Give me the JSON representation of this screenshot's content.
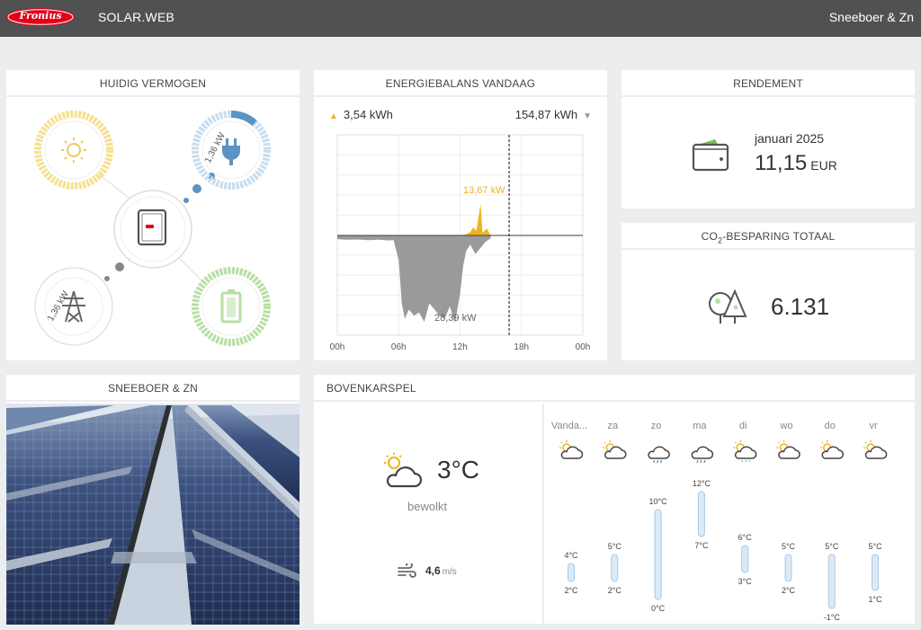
{
  "header": {
    "brand": "Fronius",
    "app_title": "SOLAR.WEB",
    "account_name": "Sneeboer & Zn",
    "brand_color": "#e2001a"
  },
  "power_flow": {
    "title": "HUIDIG VERMOGEN",
    "load_power": "1,36 kW",
    "grid_power": "1,36 kW",
    "nodes": [
      "sun-icon",
      "plug-icon",
      "inverter-icon",
      "grid-tower-icon",
      "battery-icon"
    ],
    "colors": {
      "pv": "#f6e08e",
      "load": "#a9c9e2",
      "load_accent": "#5b93c2",
      "battery": "#b7dfa2",
      "grid": "#dddddd"
    }
  },
  "energy_balance": {
    "title": "ENERGIEBALANS VANDAAG",
    "production": "3,54 kWh",
    "consumption": "154,87 kWh",
    "peak_label": "13,67 kW",
    "min_label": "28,39 kW",
    "accent": "#f0b41a",
    "chart_data": {
      "type": "area",
      "x_ticks": [
        "00h",
        "06h",
        "12h",
        "18h",
        "00h"
      ],
      "ylim": [
        -30,
        30
      ],
      "series": [
        {
          "values": [
            [
              0,
              -1.2
            ],
            [
              1,
              -1.4
            ],
            [
              2,
              -1.3
            ],
            [
              3,
              -1.5
            ],
            [
              4,
              -1.4
            ],
            [
              5,
              -1.6
            ],
            [
              5.5,
              -1.5
            ],
            [
              6,
              -8
            ],
            [
              6.3,
              -22
            ],
            [
              6.6,
              -27
            ],
            [
              7,
              -24
            ],
            [
              7.5,
              -26
            ],
            [
              8,
              -25
            ],
            [
              8.5,
              -28
            ],
            [
              9,
              -22
            ],
            [
              9.5,
              -24
            ],
            [
              10,
              -26
            ],
            [
              10.5,
              -27
            ],
            [
              11,
              -23
            ],
            [
              11.5,
              -28.4
            ],
            [
              12,
              -19
            ],
            [
              12.3,
              -10
            ],
            [
              12.6,
              -5
            ],
            [
              13,
              -3
            ],
            [
              13.5,
              -6
            ],
            [
              14,
              -4
            ],
            [
              14.5,
              -2
            ],
            [
              15,
              -1
            ]
          ]
        },
        {
          "values": [
            [
              12,
              0
            ],
            [
              12.6,
              0.5
            ],
            [
              13,
              1.5
            ],
            [
              13.3,
              3.5
            ],
            [
              13.6,
              2
            ],
            [
              14,
              13.67
            ],
            [
              14.2,
              1
            ],
            [
              14.6,
              3
            ],
            [
              15,
              0
            ]
          ]
        }
      ]
    }
  },
  "rendement": {
    "title": "RENDEMENT",
    "month": "januari 2025",
    "value": "11,15",
    "unit": "EUR"
  },
  "co2": {
    "title_pre": "CO",
    "title_sub": "2",
    "title_post": "-BESPARING TOTAAL",
    "value": "6.131"
  },
  "site": {
    "title": "SNEEBOER & ZN"
  },
  "weather": {
    "title": "BOVENKARSPEL",
    "current_temp": "3°C",
    "current_condition": "bewolkt",
    "wind_value": "4,6",
    "wind_unit": "m/s",
    "current_icon": "partly-cloudy-icon",
    "forecast": [
      {
        "day": "Vanda...",
        "icon": "sun-cloud-icon",
        "max": "4°C",
        "min": "2°C",
        "max_value": 4,
        "min_value": 2
      },
      {
        "day": "za",
        "icon": "sun-cloud-icon",
        "max": "5°C",
        "min": "2°C",
        "max_value": 5,
        "min_value": 2
      },
      {
        "day": "zo",
        "icon": "rain-icon",
        "max": "10°C",
        "min": "0°C",
        "max_value": 10,
        "min_value": 0
      },
      {
        "day": "ma",
        "icon": "rain-icon",
        "max": "12°C",
        "min": "7°C",
        "max_value": 12,
        "min_value": 7
      },
      {
        "day": "di",
        "icon": "sun-cloud-drizzle-icon",
        "max": "6°C",
        "min": "3°C",
        "max_value": 6,
        "min_value": 3
      },
      {
        "day": "wo",
        "icon": "sun-cloud-icon",
        "max": "5°C",
        "min": "2°C",
        "max_value": 5,
        "min_value": 2
      },
      {
        "day": "do",
        "icon": "sun-cloud-icon",
        "max": "5°C",
        "min": "-1°C",
        "max_value": 5,
        "min_value": -1
      },
      {
        "day": "vr",
        "icon": "sun-cloud-icon",
        "max": "5°C",
        "min": "1°C",
        "max_value": 5,
        "min_value": 1
      }
    ]
  }
}
